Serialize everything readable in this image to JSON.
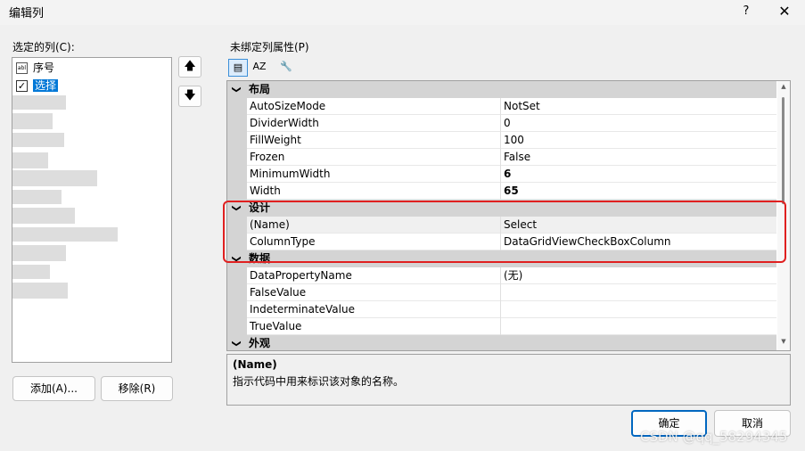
{
  "window": {
    "title": "编辑列",
    "help": "?",
    "close": "✕"
  },
  "left": {
    "label": "选定的列(C):",
    "columns": [
      {
        "label": "序号",
        "icon": "text-column-icon"
      },
      {
        "label": "选择",
        "icon": "checkbox-column-icon",
        "selected": true,
        "check": "✓"
      }
    ],
    "icon_text": "abl",
    "up_arrow": "🡅",
    "down_arrow": "🡇",
    "add_label": "添加(A)...",
    "remove_label": "移除(R)"
  },
  "right": {
    "label": "未绑定列属性(P)",
    "toolbar": {
      "categorized": "▤",
      "alpha": "AZ",
      "property_pages": "🔧"
    },
    "categories": [
      {
        "name": "布局",
        "rows": [
          {
            "name": "AutoSizeMode",
            "value": "NotSet"
          },
          {
            "name": "DividerWidth",
            "value": "0"
          },
          {
            "name": "FillWeight",
            "value": "100"
          },
          {
            "name": "Frozen",
            "value": "False"
          },
          {
            "name": "MinimumWidth",
            "value": "6",
            "bold": true
          },
          {
            "name": "Width",
            "value": "65",
            "bold": true
          }
        ]
      },
      {
        "name": "设计",
        "rows": [
          {
            "name": "(Name)",
            "value": "Select"
          },
          {
            "name": "ColumnType",
            "value": "DataGridViewCheckBoxColumn"
          }
        ]
      },
      {
        "name": "数据",
        "rows": [
          {
            "name": "DataPropertyName",
            "value": "(无)"
          },
          {
            "name": "FalseValue",
            "value": ""
          },
          {
            "name": "IndeterminateValue",
            "value": ""
          },
          {
            "name": "TrueValue",
            "value": ""
          }
        ]
      },
      {
        "name": "外观",
        "rows": []
      }
    ],
    "description": {
      "title": "(Name)",
      "text": "指示代码中用来标识该对象的名称。"
    }
  },
  "buttons": {
    "ok": "确定",
    "cancel": "取消"
  },
  "watermark": "CSDN @qq_58294345",
  "colors": {
    "accent": "#0078d7",
    "highlight_box": "#e02020"
  }
}
